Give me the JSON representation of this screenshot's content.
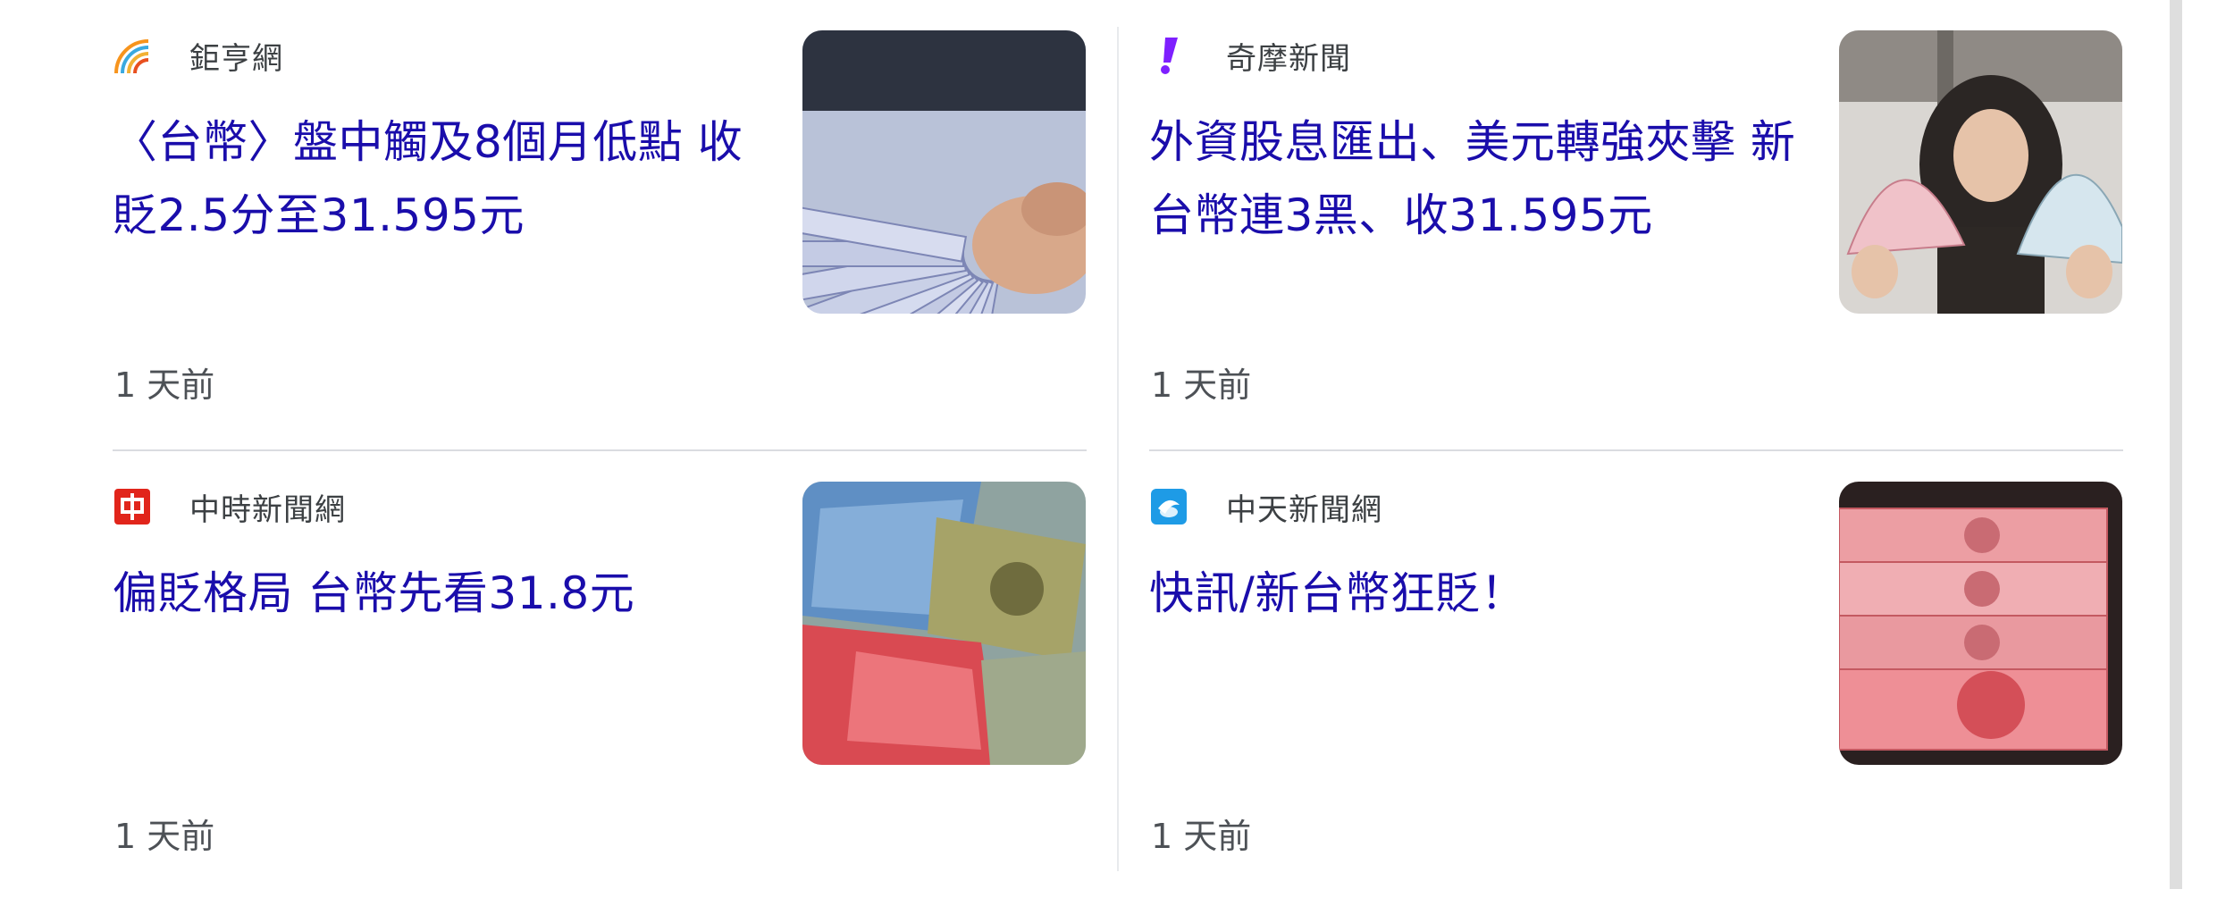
{
  "articles": [
    {
      "source": "鉅亨網",
      "source_icon": "cnyes-rainbow-logo-icon",
      "headline": "〈台幣〉盤中觸及8個月低點 收貶2.5分至31.595元",
      "time": "1 天前",
      "thumbnail": "fanned-taiwan-banknotes-photo"
    },
    {
      "source": "奇摩新聞",
      "source_icon": "yahoo-exclamation-logo-icon",
      "headline": "外資股息匯出、美元轉強夾擊 新台幣連3黑、收31.595元",
      "time": "1 天前",
      "thumbnail": "woman-holding-banknote-fans-photo"
    },
    {
      "source": "中時新聞網",
      "source_icon": "chinatimes-logo-icon",
      "headline": "偏貶格局 台幣先看31.8元",
      "time": "1 天前",
      "thumbnail": "mixed-currency-notes-photo"
    },
    {
      "source": "中天新聞網",
      "source_icon": "ctitv-logo-icon",
      "headline": "快訊/新台幣狂貶！",
      "time": "1 天前",
      "thumbnail": "red-100-banknotes-photo"
    }
  ],
  "colors": {
    "headline": "#1a0dab",
    "source_text": "#3c4043",
    "time_text": "#4d5156",
    "divider": "#dadce0"
  }
}
